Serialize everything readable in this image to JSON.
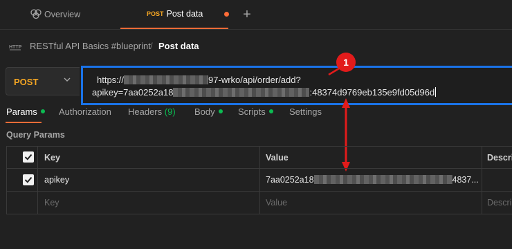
{
  "tabs": {
    "overview_label": "Overview",
    "active_method": "POST",
    "active_title": "Post data",
    "add_symbol": "+"
  },
  "breadcrumb": {
    "collection": "RESTful API Basics #blueprint",
    "separator": "/",
    "current": "Post data"
  },
  "request": {
    "method": "POST",
    "url_line1_prefix": "https://",
    "url_line1_suffix": "97-wrko/api/order/add?",
    "url_line2_prefix": "apikey=7aa0252a18",
    "url_line2_suffix": ":48374d9769eb135e9fd05d96d"
  },
  "annotation": {
    "badge": "1"
  },
  "subtabs": {
    "params": "Params",
    "authorization": "Authorization",
    "headers": "Headers",
    "headers_count": "(9)",
    "body": "Body",
    "scripts": "Scripts",
    "settings": "Settings"
  },
  "query_params": {
    "title": "Query Params",
    "columns": {
      "key": "Key",
      "value": "Value",
      "description": "Descri"
    },
    "rows": [
      {
        "key": "apikey",
        "value_prefix": "7aa0252a18",
        "value_suffix": "4837...",
        "checked": true
      }
    ],
    "placeholder": {
      "key": "Key",
      "value": "Value",
      "description": "Descri"
    }
  },
  "colors": {
    "accent": "#ff6c37",
    "post_method": "#f5a623",
    "highlight": "#1a73e8",
    "annotation": "#e21b1b",
    "status_green": "#0cbb52"
  }
}
